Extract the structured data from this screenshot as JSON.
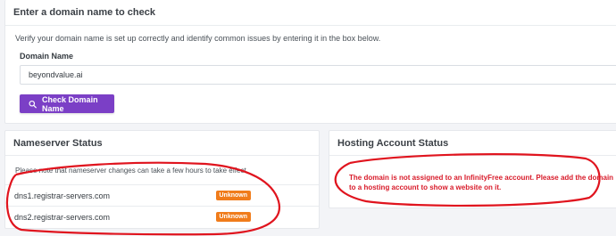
{
  "domain_card": {
    "header": "Enter a domain name to check",
    "description": "Verify your domain name is set up correctly and identify common issues by entering it in the box below.",
    "field_label": "Domain Name",
    "field_value": "beyondvalue.ai",
    "button_label": "Check Domain Name",
    "button_icon": "search-icon"
  },
  "nameserver_card": {
    "header": "Nameserver Status",
    "note": "Please note that nameserver changes can take a few hours to take effect.",
    "rows": [
      {
        "name": "dns1.registrar-servers.com",
        "status": "Unknown"
      },
      {
        "name": "dns2.registrar-servers.com",
        "status": "Unknown"
      }
    ]
  },
  "hosting_card": {
    "header": "Hosting Account Status",
    "message": "The domain is not assigned to an InfinityFree account. Please add the domain to a hosting account to show a website on it."
  },
  "colors": {
    "accent": "#7b3fc6",
    "badge": "#f07c1b",
    "error": "#d81b2a",
    "annotation": "#e0141e"
  }
}
